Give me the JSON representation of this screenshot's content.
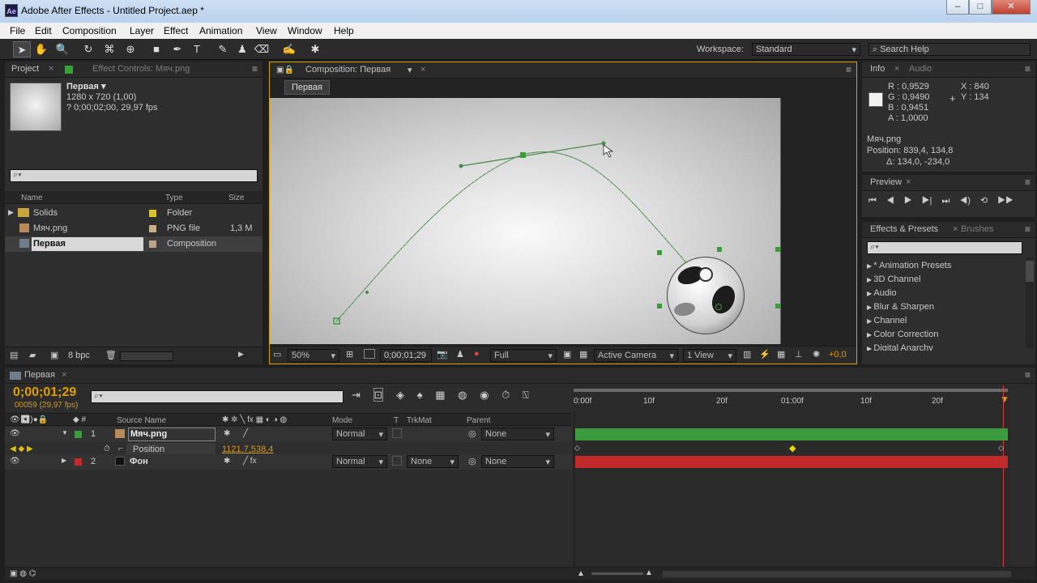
{
  "window": {
    "title": "Adobe After Effects - Untitled Project.aep *",
    "app_icon": "Ae"
  },
  "menu": [
    "File",
    "Edit",
    "Composition",
    "Layer",
    "Effect",
    "Animation",
    "View",
    "Window",
    "Help"
  ],
  "toolbar": {
    "workspace_label": "Workspace:",
    "workspace_value": "Standard",
    "search_placeholder": "Search Help"
  },
  "project": {
    "tab": "Project",
    "effects_tab": "Effect Controls: Мяч.png",
    "comp_name": "Первая ▾",
    "comp_size": "1280 x 720 (1,00)",
    "comp_duration": "? 0;00;02;00, 29,97 fps",
    "columns": {
      "name": "Name",
      "type": "Type",
      "size": "Size"
    },
    "items": [
      {
        "name": "Solids",
        "type": "Folder",
        "size": "",
        "color": "#d6c22f"
      },
      {
        "name": "Мяч.png",
        "type": "PNG file",
        "size": "1,3 M",
        "color": "#c8b08a"
      },
      {
        "name": "Первая",
        "type": "Composition",
        "size": "",
        "color": "#b8a58a"
      }
    ],
    "bpc": "8 bpc"
  },
  "composition": {
    "tab": "Composition: Первая",
    "label": "Первая",
    "zoom": "50%",
    "timecode": "0;00;01;29",
    "resolution": "Full",
    "camera": "Active Camera",
    "views": "1 View",
    "exposure": "+0,0"
  },
  "info": {
    "tab": "Info",
    "audio_tab": "Audio",
    "r": "R : 0,9529",
    "g": "G : 0,9490",
    "b": "B : 0,9451",
    "a": "A : 1,0000",
    "x": "X : 840",
    "y": "Y : 134",
    "layer": "Мяч.png",
    "position": "Position: 839,4, 134,8",
    "delta": "Δ: 134,0, -234,0"
  },
  "preview": {
    "tab": "Preview"
  },
  "effects": {
    "tab": "Effects & Presets",
    "brushes_tab": "Brushes",
    "items": [
      "* Animation Presets",
      "3D Channel",
      "Audio",
      "Blur & Sharpen",
      "Channel",
      "Color Correction",
      "Digital Anarchy"
    ]
  },
  "timeline": {
    "tab": "Первая",
    "timecode": "0;00;01;29",
    "frames": "00059 (29,97 fps)",
    "columns": {
      "source": "Source Name",
      "mode": "Mode",
      "t": "T",
      "trkmat": "TrkMat",
      "parent": "Parent"
    },
    "ruler": [
      "0:00f",
      "10f",
      "20f",
      "01:00f",
      "10f",
      "20f"
    ],
    "layers": [
      {
        "num": "1",
        "name": "Мяч.png",
        "mode": "Normal",
        "trkmat": "",
        "parent": "None",
        "color": "#3c9b3c"
      },
      {
        "num": "2",
        "name": "Фон",
        "mode": "Normal",
        "trkmat": "None",
        "parent": "None",
        "color": "#c02a2a"
      }
    ],
    "property": {
      "name": "Position",
      "value": "1121,7,538,4"
    }
  }
}
